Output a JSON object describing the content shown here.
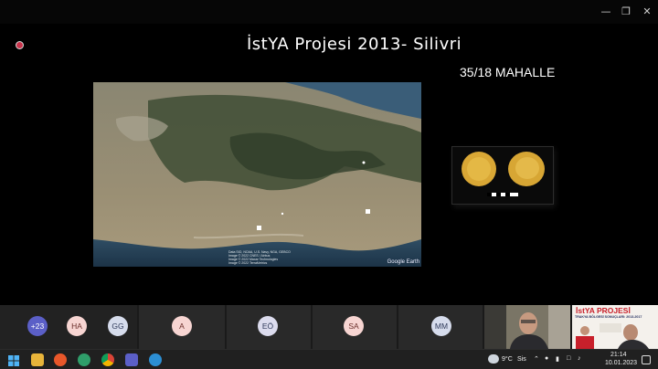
{
  "window": {
    "controls": {
      "minimize_icon": "minimize-icon",
      "restore_icon": "restore-icon",
      "close_icon": "close-icon"
    }
  },
  "slide": {
    "title": "İstYA Projesi 2013- Silivri",
    "subtitle": "35/18 MAHALLE",
    "map": {
      "credit": "Data SIO, NOAA, U.S. Navy, NGA, GEBCO\nImage © 2022 CNES / Airbus\nImage © 2022 Maxar Technologies\nImage © 2022 TerraMetrics",
      "logo": "Google Earth"
    }
  },
  "participants": [
    {
      "label": "+23",
      "color": "#5b5fc7",
      "text_color": "#ffffff"
    },
    {
      "label": "HA",
      "color": "#f7d5d2",
      "text_color": "#6b2e2a"
    },
    {
      "label": "GG",
      "color": "#d6dcec",
      "text_color": "#2f3a5a"
    },
    {
      "label": "A",
      "color": "#f7d5d2",
      "text_color": "#6b2e2a"
    },
    {
      "label": "EÖ",
      "color": "#dcdcee",
      "text_color": "#2f3a5a"
    },
    {
      "label": "SA",
      "color": "#f7d5d2",
      "text_color": "#6b2e2a"
    },
    {
      "label": "MM",
      "color": "#d6dcec",
      "text_color": "#2f3a5a"
    }
  ],
  "poster": {
    "title": "İstYA PROJESİ",
    "subtitle": "TRAKYA BÖLGESİ SONUÇLARI: 2013-2017"
  },
  "taskbar": {
    "weather_temp": "9°C",
    "weather_desc": "Sis",
    "time": "21:14",
    "date": "10.01.2023"
  }
}
